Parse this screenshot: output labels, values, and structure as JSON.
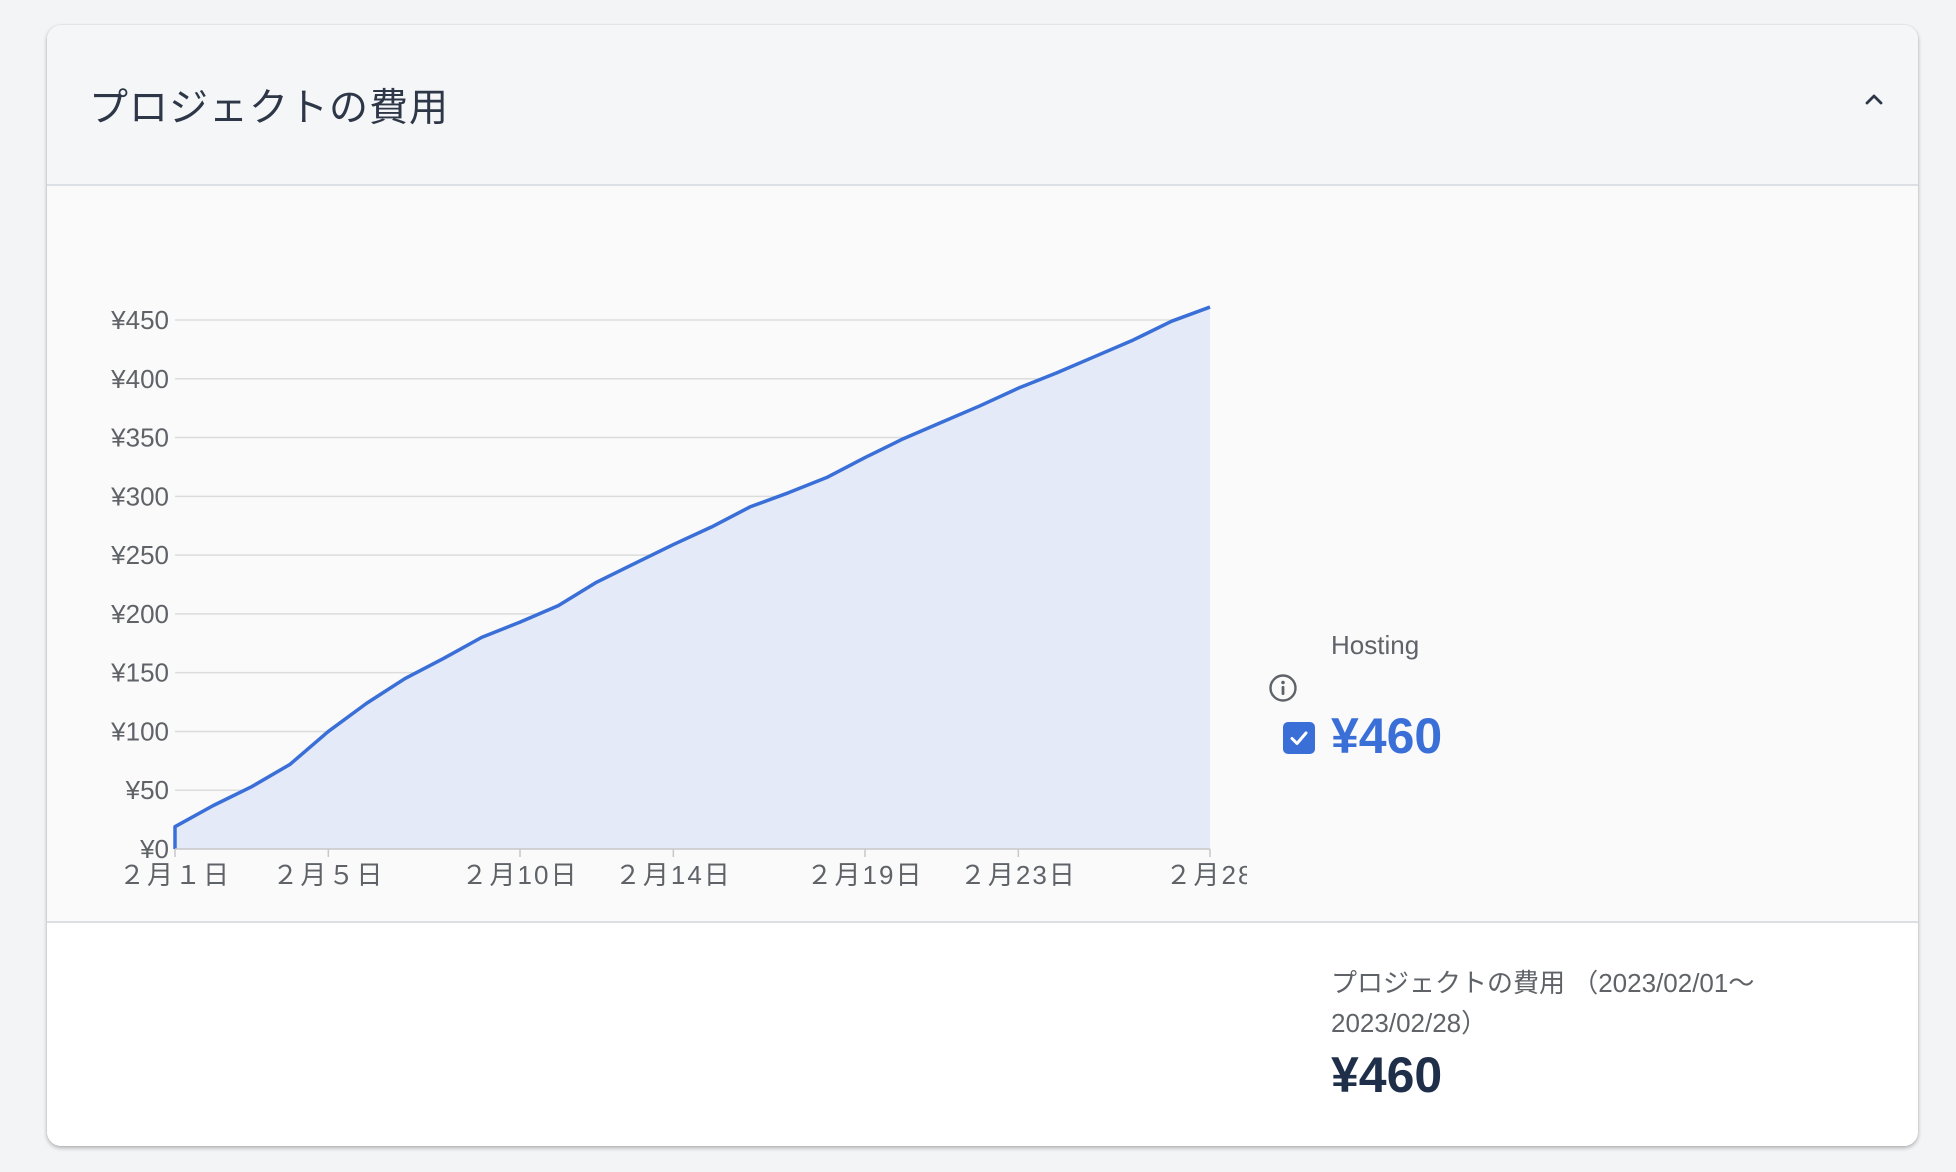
{
  "header": {
    "title": "プロジェクトの費用"
  },
  "legend": {
    "series_name": "Hosting",
    "value": "¥460"
  },
  "footer": {
    "label": "プロジェクトの費用 （2023/02/01〜2023/02/28）",
    "total": "¥460"
  },
  "colors": {
    "line": "#3a6fd8",
    "fill": "#e4eaf7",
    "grid": "#dcdcdc"
  },
  "chart_data": {
    "type": "area",
    "title": "",
    "xlabel": "",
    "ylabel": "",
    "ylim": [
      0,
      450
    ],
    "grid": true,
    "y_ticks": [
      0,
      50,
      100,
      150,
      200,
      250,
      300,
      350,
      400,
      450
    ],
    "y_tick_labels": [
      "¥0",
      "¥50",
      "¥100",
      "¥150",
      "¥200",
      "¥250",
      "¥300",
      "¥350",
      "¥400",
      "¥450"
    ],
    "x_ticks": [
      1,
      5,
      10,
      14,
      19,
      23,
      28
    ],
    "x_tick_labels": [
      "２月１日",
      "２月５日",
      "２月10日",
      "２月14日",
      "２月19日",
      "２月23日",
      "２月28"
    ],
    "series": [
      {
        "name": "Hosting",
        "x": [
          1,
          2,
          3,
          4,
          5,
          6,
          7,
          8,
          9,
          10,
          11,
          12,
          13,
          14,
          15,
          16,
          17,
          18,
          19,
          20,
          21,
          22,
          23,
          24,
          25,
          26,
          27,
          28
        ],
        "values": [
          19,
          37,
          53,
          72,
          100,
          124,
          145,
          162,
          180,
          193,
          207,
          227,
          243,
          259,
          274,
          291,
          303,
          316,
          333,
          349,
          363,
          377,
          392,
          405,
          419,
          433,
          449,
          461
        ]
      }
    ]
  }
}
